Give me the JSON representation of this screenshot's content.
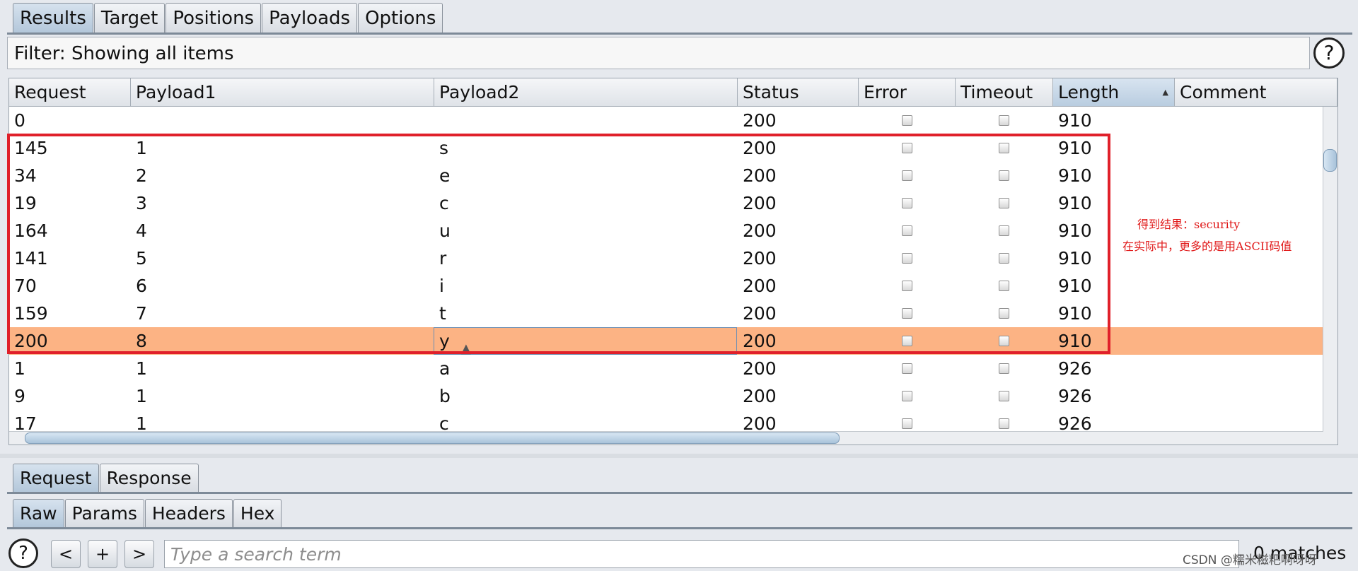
{
  "main_tabs": [
    "Results",
    "Target",
    "Positions",
    "Payloads",
    "Options"
  ],
  "filter_text": "Filter: Showing all items",
  "help_glyph": "?",
  "columns": [
    "Request",
    "Payload1",
    "Payload2",
    "Status",
    "Error",
    "Timeout",
    "Length",
    "Comment"
  ],
  "sorted_column": "Length",
  "rows": [
    {
      "request": "0",
      "payload1": "",
      "payload2": "",
      "status": "200",
      "length": "910",
      "comment": ""
    },
    {
      "request": "145",
      "payload1": "1",
      "payload2": "s",
      "status": "200",
      "length": "910",
      "comment": ""
    },
    {
      "request": "34",
      "payload1": "2",
      "payload2": "e",
      "status": "200",
      "length": "910",
      "comment": ""
    },
    {
      "request": "19",
      "payload1": "3",
      "payload2": "c",
      "status": "200",
      "length": "910",
      "comment": ""
    },
    {
      "request": "164",
      "payload1": "4",
      "payload2": "u",
      "status": "200",
      "length": "910",
      "comment": ""
    },
    {
      "request": "141",
      "payload1": "5",
      "payload2": "r",
      "status": "200",
      "length": "910",
      "comment": ""
    },
    {
      "request": "70",
      "payload1": "6",
      "payload2": "i",
      "status": "200",
      "length": "910",
      "comment": ""
    },
    {
      "request": "159",
      "payload1": "7",
      "payload2": "t",
      "status": "200",
      "length": "910",
      "comment": ""
    },
    {
      "request": "200",
      "payload1": "8",
      "payload2": "y",
      "status": "200",
      "length": "910",
      "comment": ""
    },
    {
      "request": "1",
      "payload1": "1",
      "payload2": "a",
      "status": "200",
      "length": "926",
      "comment": ""
    },
    {
      "request": "9",
      "payload1": "1",
      "payload2": "b",
      "status": "200",
      "length": "926",
      "comment": ""
    },
    {
      "request": "17",
      "payload1": "1",
      "payload2": "c",
      "status": "200",
      "length": "926",
      "comment": ""
    }
  ],
  "selected_row": 8,
  "annotation": {
    "line1": "得到结果：security",
    "line2": "在实际中，更多的是用ASCII码值",
    "color": "#e01818"
  },
  "msg_tabs": [
    "Request",
    "Response"
  ],
  "view_tabs": [
    "Raw",
    "Params",
    "Headers",
    "Hex"
  ],
  "search": {
    "help_glyph": "?",
    "prev_label": "<",
    "add_label": "+",
    "next_label": ">",
    "placeholder": "Type a search term",
    "matches": "0 matches"
  },
  "watermark": "CSDN @糯米糍粑啊呀呀",
  "colors": {
    "selected_row": "#fcb384",
    "highlight_box": "#e0202a",
    "sorted_header": "#b9cde0"
  }
}
